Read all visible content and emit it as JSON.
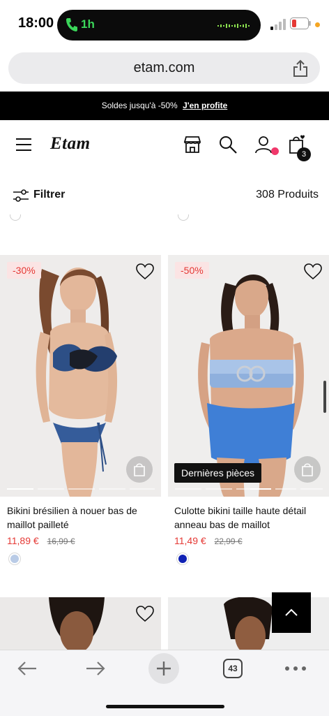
{
  "status_bar": {
    "time": "18:00",
    "call_duration": "1h"
  },
  "browser": {
    "url": "etam.com",
    "tab_count": "43"
  },
  "promo": {
    "text": "Soldes jusqu'à -50%",
    "link": "J'en profite"
  },
  "header": {
    "logo": "Etam",
    "cart_count": "3"
  },
  "filter": {
    "label": "Filtrer",
    "products_count": "308 Produits"
  },
  "products": [
    {
      "badge": "-30%",
      "title": "Bikini brésilien à nouer bas de maillot pailleté",
      "price": "11,89 €",
      "old_price": "16,99 €",
      "swatch_color": "#b9cbe6"
    },
    {
      "badge": "-50%",
      "title": "Culotte bikini taille haute détail anneau bas de maillot",
      "price": "11,49 €",
      "old_price": "22,99 €",
      "swatch_color": "#1022b4",
      "tag": "Dernières pièces"
    }
  ],
  "colors": {
    "accent_red": "#e53935",
    "promo_bg": "#000000",
    "account_dot": "#f0386b"
  }
}
